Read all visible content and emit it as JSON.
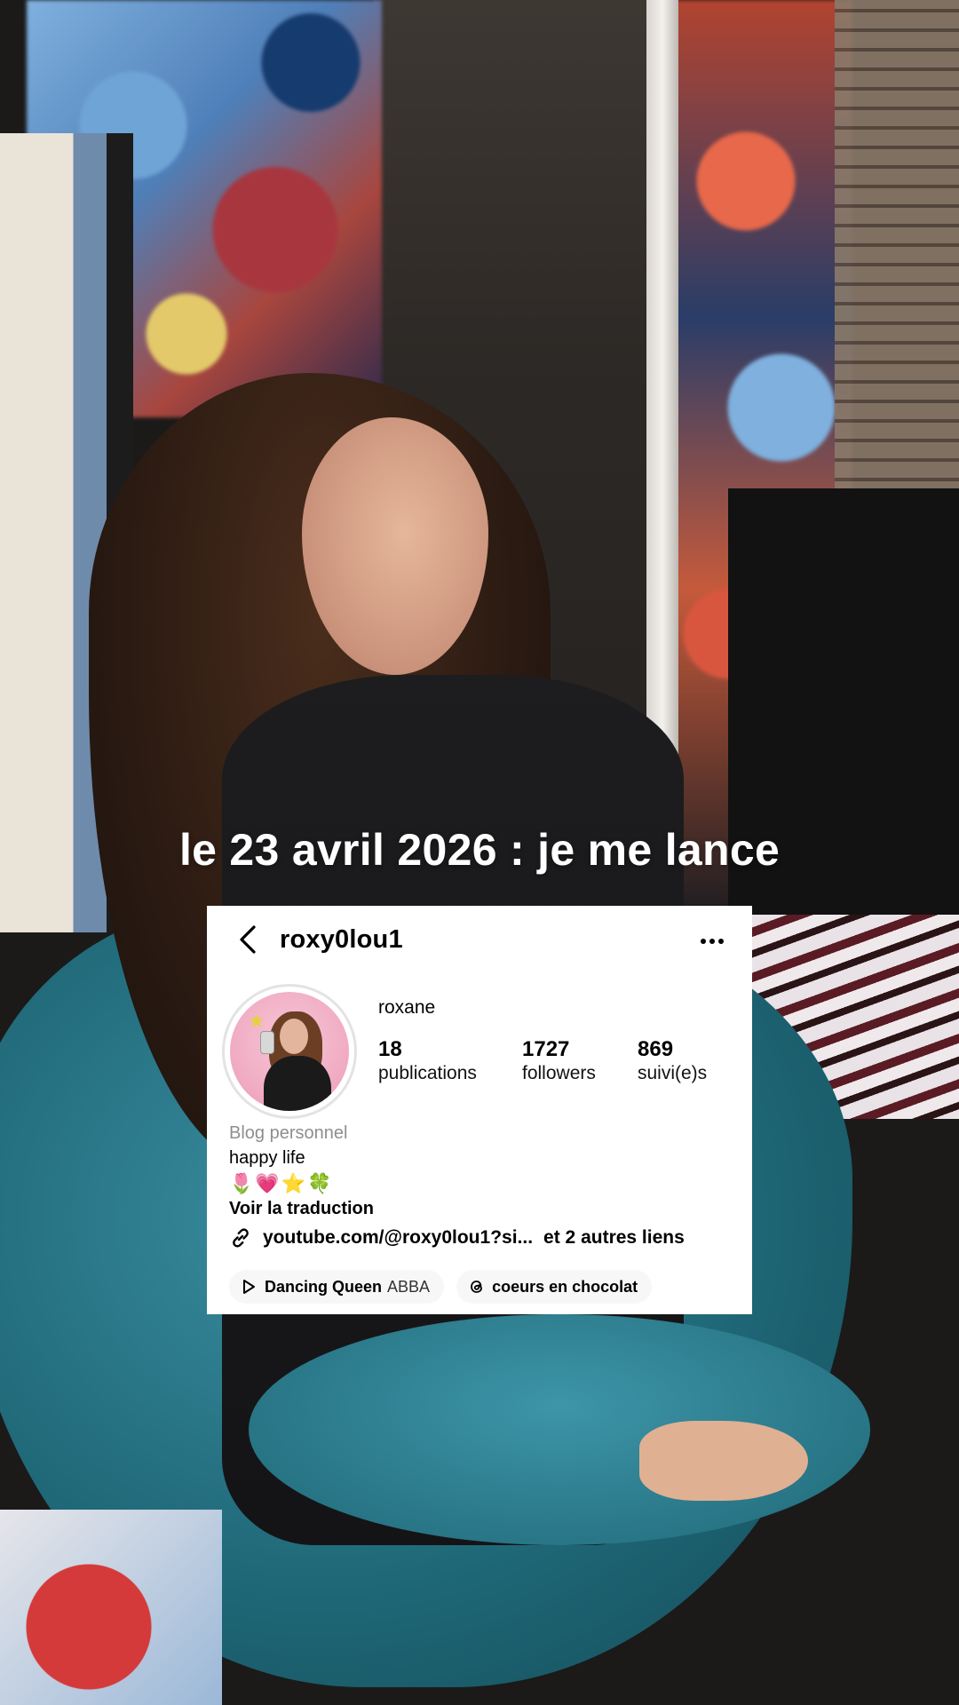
{
  "caption": "le 23 avril 2026 : je me lance",
  "profile": {
    "username": "roxy0lou1",
    "display_name": "roxane",
    "stats": {
      "posts_count": "18",
      "posts_label": "publications",
      "followers_count": "1727",
      "followers_label": "followers",
      "following_count": "869",
      "following_label": "suivi(e)s"
    },
    "category": "Blog personnel",
    "bio_text": "happy life",
    "bio_emojis": "🌷💗⭐🍀",
    "translate_label": "Voir la traduction",
    "link": {
      "url_text": "youtube.com/@roxy0lou1?si...",
      "more_links": "et 2 autres liens"
    },
    "music_chip": {
      "song": "Dancing Queen",
      "artist": "ABBA"
    },
    "threads_chip": {
      "label": "coeurs en chocolat"
    }
  },
  "icons": {
    "back": "chevron-left-icon",
    "more": "more-horizontal-icon",
    "link": "link-icon",
    "play": "play-icon",
    "threads": "threads-icon"
  },
  "colors": {
    "card_background": "#ffffff",
    "caption_text": "#ffffff",
    "category_text": "#8e8e8e",
    "chip_background": "#f7f7f7"
  }
}
